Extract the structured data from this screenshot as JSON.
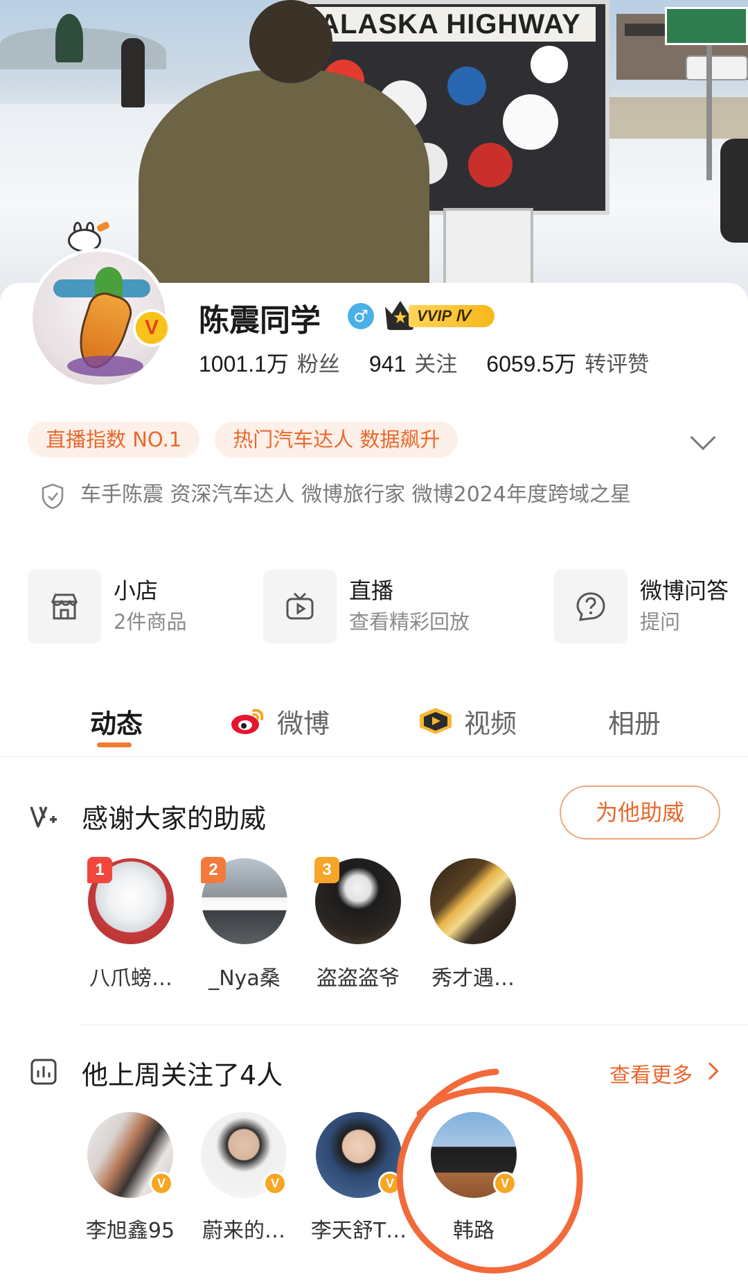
{
  "profile": {
    "name": "陈震同学",
    "gender_symbol": "♂",
    "vvip_label": "VVIP Ⅳ",
    "verified_symbol": "V",
    "stats": [
      {
        "value": "1001.1万",
        "label": "粉丝"
      },
      {
        "value": "941",
        "label": "关注"
      },
      {
        "value": "6059.5万",
        "label": "转评赞"
      }
    ],
    "tags": [
      "直播指数 NO.1",
      "热门汽车达人 数据飙升"
    ],
    "certification": "车手陈震 资深汽车达人  微博旅行家  微博2024年度跨域之星"
  },
  "cover": {
    "sign_text": "ALASKA HIGHWAY"
  },
  "services": [
    {
      "title": "小店",
      "subtitle": "2件商品",
      "icon": "shop-icon"
    },
    {
      "title": "直播",
      "subtitle": "查看精彩回放",
      "icon": "tv-icon"
    },
    {
      "title": "微博问答",
      "subtitle": "提问",
      "icon": "question-icon"
    }
  ],
  "tabs": [
    {
      "label": "动态",
      "active": true
    },
    {
      "label": "微博",
      "active": false,
      "icon": "weibo-logo-icon"
    },
    {
      "label": "视频",
      "active": false,
      "icon": "video-badge-icon"
    },
    {
      "label": "相册",
      "active": false
    }
  ],
  "support": {
    "title": "感谢大家的助威",
    "button": "为他助威",
    "fans": [
      {
        "rank": "1",
        "name": "八爪螃…"
      },
      {
        "rank": "2",
        "name": "_Nya桑"
      },
      {
        "rank": "3",
        "name": "盗盗盗爷"
      },
      {
        "rank": "",
        "name": "秀才遇…"
      }
    ]
  },
  "follows": {
    "title": "他上周关注了4人",
    "see_more": "查看更多",
    "users": [
      {
        "name": "李旭鑫95",
        "verified": true
      },
      {
        "name": "蔚来的…",
        "verified": true
      },
      {
        "name": "李天舒T…",
        "verified": true
      },
      {
        "name": "韩路",
        "verified": true
      }
    ]
  },
  "colors": {
    "accent": "#e8682e",
    "tag_bg": "#fdf0e8",
    "rank1": "#f0483e",
    "rank2": "#f37a3c",
    "rank3": "#f6a42a",
    "annotation_circle": "#f26a3a"
  }
}
